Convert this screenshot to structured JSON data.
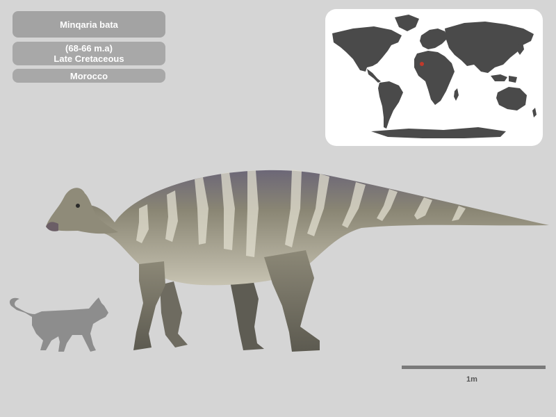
{
  "species": {
    "name": "Minqaria bata"
  },
  "age": {
    "range": "(68-66 m.a)",
    "period": "Late Cretaceous"
  },
  "location": {
    "country": "Morocco"
  },
  "scale": {
    "label": "1m"
  },
  "colors": {
    "background": "#d5d5d5",
    "pill": "#a8a8a8",
    "land": "#4a4a4a",
    "locator": "#c0392b",
    "silhouette": "#8d8d8d",
    "dino_body": "#8a8674",
    "dino_stripe": "#e2dfd0"
  },
  "icons": {
    "map": "world-map-icon",
    "cat": "cat-silhouette-icon"
  }
}
